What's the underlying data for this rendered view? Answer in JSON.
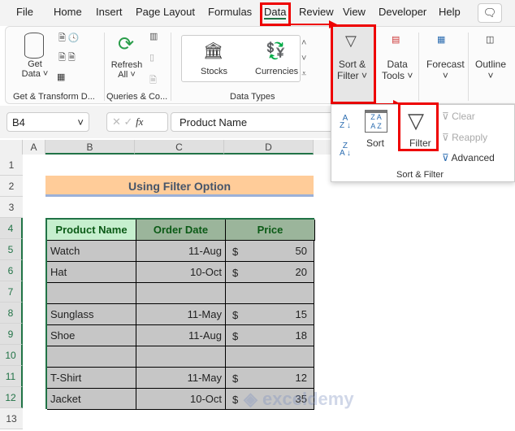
{
  "tabs": [
    "File",
    "Home",
    "Insert",
    "Page Layout",
    "Formulas",
    "Data",
    "Review",
    "View",
    "Developer",
    "Help"
  ],
  "active_tab": "Data",
  "ribbon": {
    "get_data": "Get",
    "get_data2": "Data",
    "refresh": "Refresh",
    "refresh2": "All",
    "stocks": "Stocks",
    "currencies": "Currencies",
    "sort_filter": "Sort &",
    "sort_filter2": "Filter",
    "data_tools": "Data",
    "data_tools2": "Tools",
    "forecast": "Forecast",
    "outline": "Outline",
    "groups": [
      "Get & Transform D...",
      "Queries & Co...",
      "Data Types"
    ]
  },
  "sort_filter_menu": {
    "sort": "Sort",
    "filter": "Filter",
    "clear": "Clear",
    "reapply": "Reapply",
    "advanced": "Advanced",
    "group": "Sort & Filter"
  },
  "formula_bar": {
    "name_box": "B4",
    "content": "Product Name",
    "fx": "fx"
  },
  "columns": [
    "A",
    "B",
    "C",
    "D"
  ],
  "rows": [
    "1",
    "2",
    "3",
    "4",
    "5",
    "6",
    "7",
    "8",
    "9",
    "10",
    "11",
    "12",
    "13"
  ],
  "sheet": {
    "title": "Using Filter Option",
    "headers": [
      "Product Name",
      "Order Date",
      "Price"
    ],
    "data": [
      [
        "Watch",
        "11-Aug",
        "$",
        "50"
      ],
      [
        "Hat",
        "10-Oct",
        "$",
        "20"
      ],
      [
        "",
        "",
        "",
        ""
      ],
      [
        "Sunglass",
        "11-May",
        "$",
        "15"
      ],
      [
        "Shoe",
        "11-Aug",
        "$",
        "18"
      ],
      [
        "",
        "",
        "",
        ""
      ],
      [
        "T-Shirt",
        "11-May",
        "$",
        "12"
      ],
      [
        "Jacket",
        "10-Oct",
        "$",
        "35"
      ]
    ]
  },
  "watermark": "exceldemy",
  "colors": {
    "accent": "#217346",
    "highlight": "#ff0000",
    "title_fill": "#ffcc99",
    "header_fill": "#9bb59b",
    "data_fill": "#c6c6c6"
  }
}
